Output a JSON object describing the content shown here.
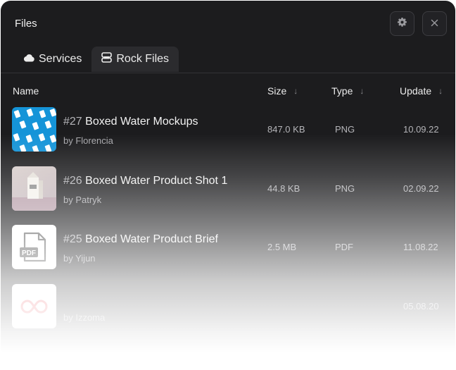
{
  "window": {
    "title": "Files",
    "settings_icon": "gear-icon",
    "close_icon": "close-icon"
  },
  "tabs": [
    {
      "label": "Services",
      "icon": "cloud-icon",
      "active": false
    },
    {
      "label": "Rock Files",
      "icon": "storage-icon",
      "active": true
    }
  ],
  "table": {
    "columns": [
      {
        "label": "Name",
        "sortable": false
      },
      {
        "label": "Size",
        "sortable": true
      },
      {
        "label": "Type",
        "sortable": true
      },
      {
        "label": "Update",
        "sortable": true
      }
    ],
    "sort_icon": "arrow-down-icon",
    "rows": [
      {
        "number": "#27",
        "name": "Boxed Water Mockups",
        "author": "by Florencia",
        "size": "847.0 KB",
        "type": "PNG",
        "date": "10.09.22",
        "thumb": "pattern-thumbnail"
      },
      {
        "number": "#26",
        "name": "Boxed Water Product Shot 1",
        "author": "by Patryk",
        "size": "44.8 KB",
        "type": "PNG",
        "date": "02.09.22",
        "thumb": "product-photo-thumbnail"
      },
      {
        "number": "#25",
        "name": "Boxed Water Product Brief",
        "author": "by Yijun",
        "size": "2.5 MB",
        "type": "PDF",
        "date": "11.08.22",
        "thumb": "pdf-icon"
      },
      {
        "number": "",
        "name": "",
        "author": "by Izzoma",
        "size": "",
        "type": "",
        "date": "05.08.20",
        "thumb": "creative-cloud-icon"
      }
    ]
  },
  "colors": {
    "panel_bg": "#1c1c1e",
    "active_tab_bg": "#2b2b2e",
    "creative_cloud_red": "#e8474f"
  }
}
